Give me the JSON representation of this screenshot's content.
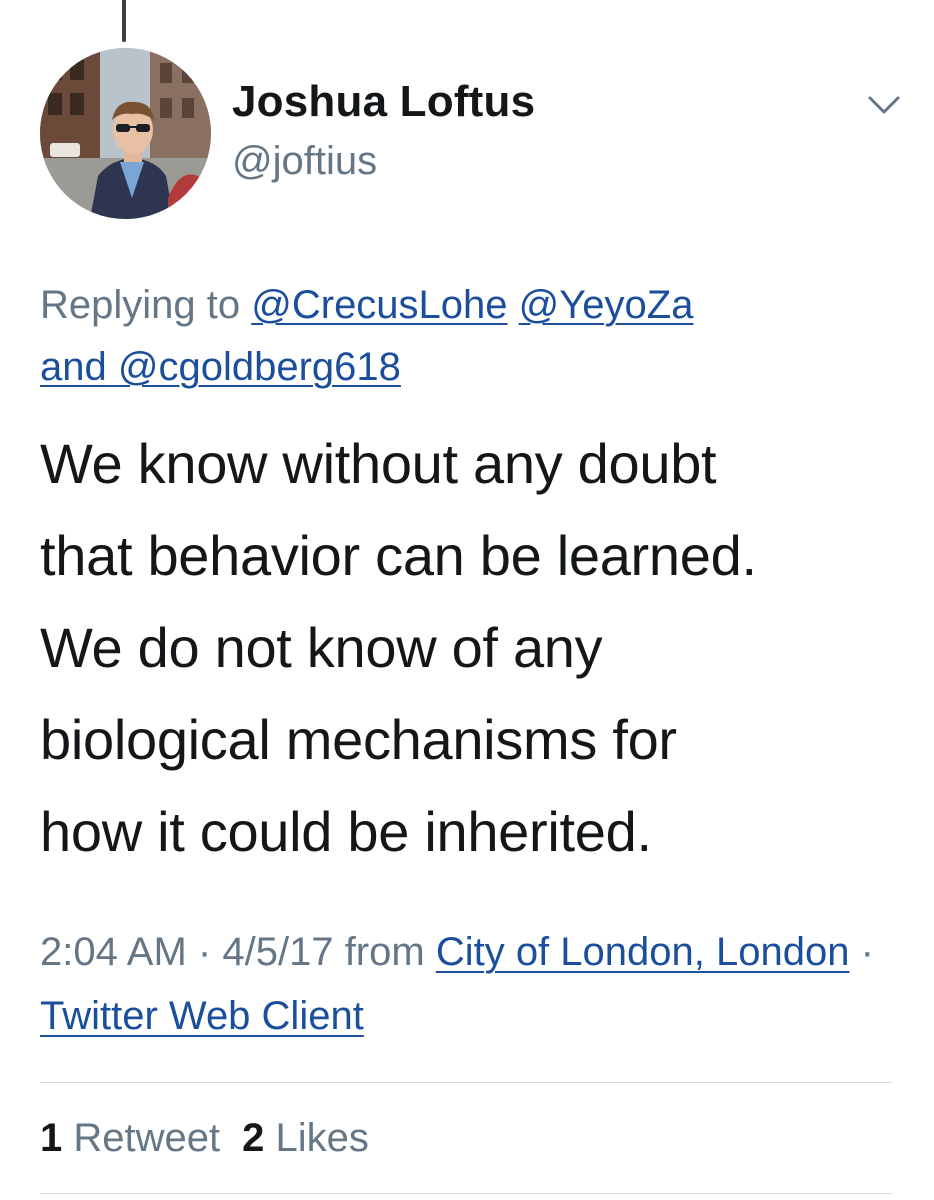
{
  "author": {
    "name": "Joshua Loftus",
    "handle": "@joftius"
  },
  "icons": {
    "menu": "chevron-down-icon",
    "avatar": "profile-photo"
  },
  "reply": {
    "prefix": "Replying to",
    "mention_1": "@CrecusLohe",
    "mention_2": "@YeyoZa",
    "conjunction": "and",
    "mention_3": "@cgoldberg618"
  },
  "tweet": {
    "lines": [
      "We know without any doubt",
      "that behavior can be learned.",
      "We do not know of any",
      "biological mechanisms for",
      "how it could be inherited."
    ]
  },
  "meta": {
    "time": "2:04 AM",
    "separator": "·",
    "date": "4/5/17",
    "from_label": "from",
    "location": "City of London, London",
    "client": "Twitter Web Client"
  },
  "stats": {
    "retweets_count": "1",
    "retweets_label": "Retweet",
    "likes_count": "2",
    "likes_label": "Likes"
  },
  "colors": {
    "text": "#14171a",
    "secondary": "#657786",
    "link": "#1b4f9c",
    "divider": "#d6dadd"
  }
}
